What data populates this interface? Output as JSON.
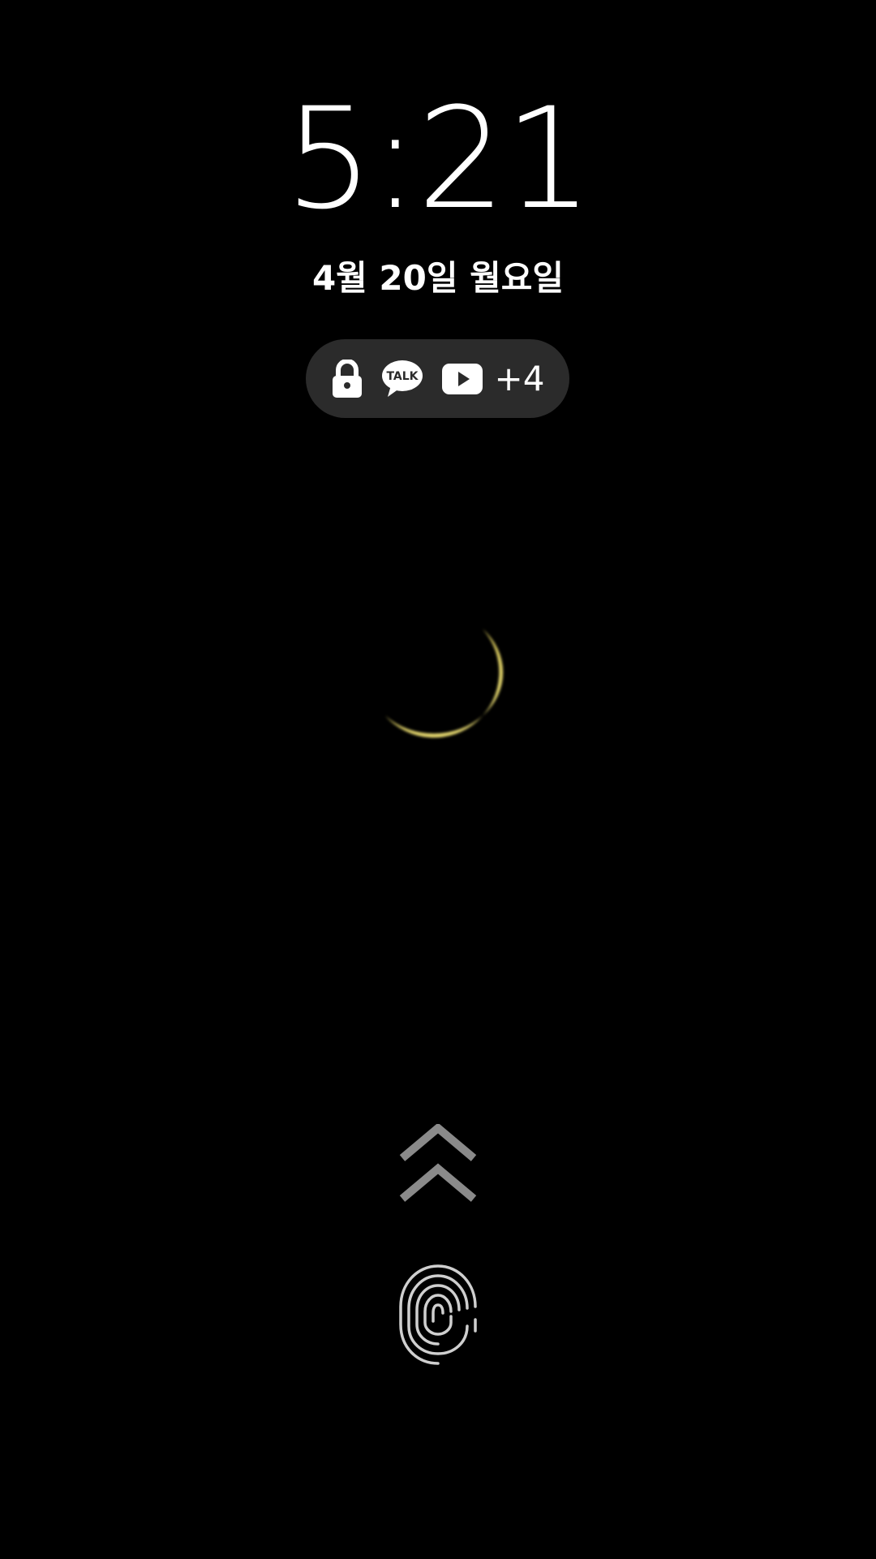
{
  "lockscreen": {
    "time": "5:21",
    "date": "4월 20일 월요일"
  },
  "notifications": {
    "icons": [
      "lock-icon",
      "kakaotalk-icon",
      "youtube-icon"
    ],
    "kakaotalk_label": "TALK",
    "more_count": "+4"
  },
  "wallpaper": {
    "subject": "crescent-moon",
    "moon_color": "#efe27a"
  },
  "colors": {
    "background": "#000000",
    "pill": "#2b2b2b",
    "text": "#ffffff",
    "hint": "#8a8a8a"
  },
  "bottom": {
    "swipe_hint_icon": "double-chevron-up-icon",
    "fingerprint_icon": "fingerprint-icon"
  }
}
